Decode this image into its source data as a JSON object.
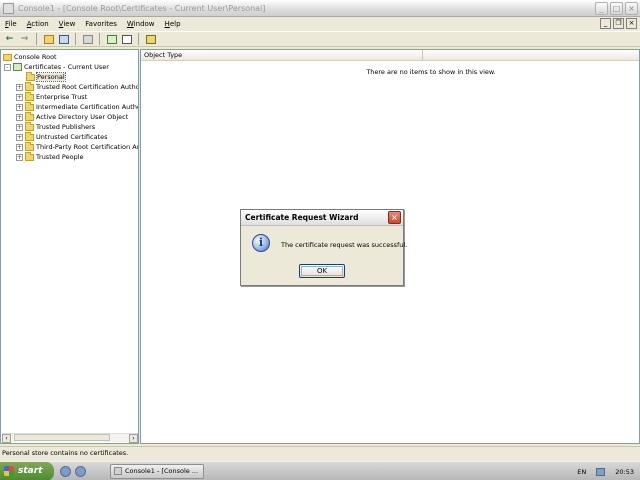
{
  "window": {
    "title": "Console1 - [Console Root\\Certificates - Current User\\Personal]",
    "controls": {
      "minimize": "_",
      "maximize": "□",
      "close": "×"
    }
  },
  "menubar": {
    "items": [
      {
        "key": "F",
        "rest": "ile"
      },
      {
        "key": "A",
        "rest": "ction"
      },
      {
        "key": "V",
        "rest": "iew"
      },
      {
        "key": "",
        "rest": "Favorites"
      },
      {
        "key": "W",
        "rest": "indow"
      },
      {
        "key": "H",
        "rest": "elp"
      }
    ],
    "mdi_controls": {
      "minimize": "_",
      "restore": "❐",
      "close": "×"
    }
  },
  "toolbar": {
    "back": "←",
    "forward": "→"
  },
  "tree": {
    "root": "Console Root",
    "certificates": "Certificates - Current User",
    "items": [
      "Personal",
      "Trusted Root Certification Author",
      "Enterprise Trust",
      "Intermediate Certification Author",
      "Active Directory User Object",
      "Trusted Publishers",
      "Untrusted Certificates",
      "Third-Party Root Certification Au",
      "Trusted People"
    ],
    "expander_collapsed": "+",
    "expander_expanded": "-"
  },
  "list": {
    "column_header": "Object Type",
    "empty_message": "There are no items to show in this view."
  },
  "status": {
    "text": "Personal store contains no certificates."
  },
  "taskbar": {
    "start_label": "start",
    "task_label": "Console1 - [Console ...",
    "language": "EN",
    "time": "20:53"
  },
  "dialog": {
    "title": "Certificate Request Wizard",
    "message": "The certificate request was successful.",
    "ok_label": "OK",
    "close": "×",
    "icon_glyph": "i"
  },
  "scrollbar": {
    "left": "‹",
    "right": "›"
  }
}
